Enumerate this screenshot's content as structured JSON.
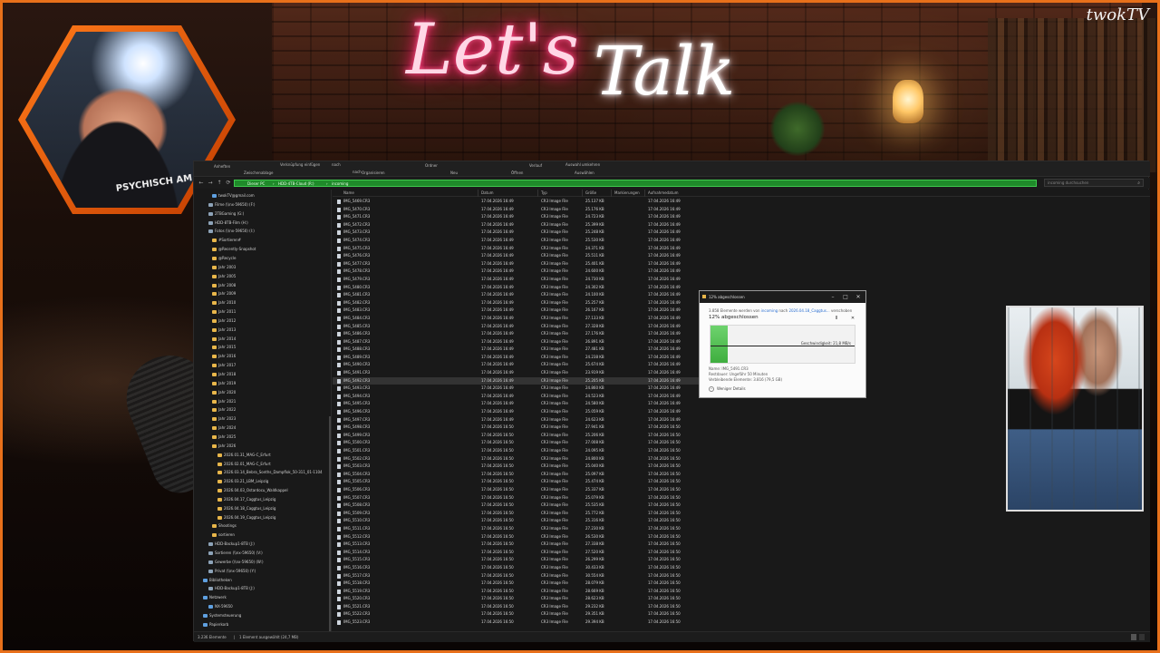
{
  "overlay": {
    "title_part1": "Let's",
    "title_part2": "Talk",
    "brand": "twokTV",
    "webcam_shirt": "PSYCHISCH AM",
    "colors": {
      "frame": "#e8701a",
      "neon_pink": "#ff2a70",
      "progress_green": "#3fae3f",
      "address_green": "#1f8a2a"
    }
  },
  "explorer": {
    "ribbon": [
      "Anheften",
      "Zwischenablage",
      "Verknüpfung einfügen",
      "nach",
      "nach",
      "Organisieren",
      "Ordner",
      "Neu",
      "Öffnen",
      "Verlauf",
      "Auswahl umkehren",
      "Auswählen"
    ],
    "breadcrumbs": [
      "Dieser PC",
      "HDD-4TB-Cloud (R:)",
      "incoming"
    ],
    "search_placeholder": "incoming durchsuchen",
    "nav_tree": [
      {
        "label": "twokTV@gmail.com",
        "icon": "user-icon"
      },
      {
        "label": "Filme (\\\\nx-59650) (F:)",
        "icon": "drive-icon"
      },
      {
        "label": "2TBGaming (G:)",
        "icon": "drive-icon"
      },
      {
        "label": "HDD-8TB-Film (H:)",
        "icon": "drive-icon"
      },
      {
        "label": "Fotos (\\\\nx-59650) (I:)",
        "icon": "drive-icon"
      },
      {
        "label": "#Sortieren#",
        "icon": "folder-icon"
      },
      {
        "label": "@Recently-Snapshot",
        "icon": "folder-icon"
      },
      {
        "label": "@Recycle",
        "icon": "folder-icon"
      },
      {
        "label": "Jahr 2003",
        "icon": "folder-icon"
      },
      {
        "label": "Jahr 2005",
        "icon": "folder-icon"
      },
      {
        "label": "Jahr 2008",
        "icon": "folder-icon"
      },
      {
        "label": "Jahr 2009",
        "icon": "folder-icon"
      },
      {
        "label": "Jahr 2010",
        "icon": "folder-icon"
      },
      {
        "label": "Jahr 2011",
        "icon": "folder-icon"
      },
      {
        "label": "Jahr 2012",
        "icon": "folder-icon"
      },
      {
        "label": "Jahr 2013",
        "icon": "folder-icon"
      },
      {
        "label": "Jahr 2014",
        "icon": "folder-icon"
      },
      {
        "label": "Jahr 2015",
        "icon": "folder-icon"
      },
      {
        "label": "Jahr 2016",
        "icon": "folder-icon"
      },
      {
        "label": "Jahr 2017",
        "icon": "folder-icon"
      },
      {
        "label": "Jahr 2018",
        "icon": "folder-icon"
      },
      {
        "label": "Jahr 2019",
        "icon": "folder-icon"
      },
      {
        "label": "Jahr 2020",
        "icon": "folder-icon"
      },
      {
        "label": "Jahr 2021",
        "icon": "folder-icon"
      },
      {
        "label": "Jahr 2022",
        "icon": "folder-icon"
      },
      {
        "label": "Jahr 2023",
        "icon": "folder-icon"
      },
      {
        "label": "Jahr 2024",
        "icon": "folder-icon"
      },
      {
        "label": "Jahr 2025",
        "icon": "folder-icon"
      },
      {
        "label": "Jahr 2026",
        "icon": "folder-icon"
      },
      {
        "label": "2026.01.31_MAG-C_Erfurt",
        "icon": "folder-icon"
      },
      {
        "label": "2026.02.01_MAG-C_Erfurt",
        "icon": "folder-icon"
      },
      {
        "label": "2026.03.14_Bebra_Sonths_Dampflok_50-311_01-1104",
        "icon": "folder-icon"
      },
      {
        "label": "2026.03.21_LBM_Leipzig",
        "icon": "folder-icon"
      },
      {
        "label": "2026.04.03_Ostardocu_Waldkappel",
        "icon": "folder-icon"
      },
      {
        "label": "2026.04.17_Caggtus_Leipzig",
        "icon": "folder-icon"
      },
      {
        "label": "2026.04.18_Caggtus_Leipzig",
        "icon": "folder-icon"
      },
      {
        "label": "2026.04.19_Caggtus_Leipzig",
        "icon": "folder-icon"
      },
      {
        "label": "Shootings",
        "icon": "folder-icon"
      },
      {
        "label": "sortieren",
        "icon": "folder-icon"
      },
      {
        "label": "HDD-Backup1-8TB (J:)",
        "icon": "drive-icon"
      },
      {
        "label": "Sortieren (\\\\nx-59650) (V:)",
        "icon": "drive-icon"
      },
      {
        "label": "Gewerbe (\\\\nx-59650) (W:)",
        "icon": "drive-icon"
      },
      {
        "label": "Privat (\\\\nx-59650) (Y:)",
        "icon": "drive-icon"
      },
      {
        "label": "Bibliotheken",
        "icon": "library-icon"
      },
      {
        "label": "HDD-Backup1-8TB (J:)",
        "icon": "drive-icon"
      },
      {
        "label": "Netzwerk",
        "icon": "network-icon"
      },
      {
        "label": "NX-59650",
        "icon": "computer-icon"
      },
      {
        "label": "Systemsteuerung",
        "icon": "control-panel-icon"
      },
      {
        "label": "Papierkorb",
        "icon": "recycle-bin-icon"
      }
    ],
    "columns": [
      "Name",
      "Datum",
      "Typ",
      "Größe",
      "Markierungen",
      "Aufnahmedatum"
    ],
    "files": [
      {
        "name": "IMG_5469.CR3",
        "date": "17.04.2026 16:49",
        "type": "CR3 Image File",
        "size": "25.137 KB",
        "taken": "17.04.2026 16:49"
      },
      {
        "name": "IMG_5470.CR3",
        "date": "17.04.2026 16:49",
        "type": "CR3 Image File",
        "size": "25.176 KB",
        "taken": "17.04.2026 16:49"
      },
      {
        "name": "IMG_5471.CR3",
        "date": "17.04.2026 16:49",
        "type": "CR3 Image File",
        "size": "24.723 KB",
        "taken": "17.04.2026 16:49"
      },
      {
        "name": "IMG_5472.CR3",
        "date": "17.04.2026 16:49",
        "type": "CR3 Image File",
        "size": "25.399 KB",
        "taken": "17.04.2026 16:49"
      },
      {
        "name": "IMG_5473.CR3",
        "date": "17.04.2026 16:49",
        "type": "CR3 Image File",
        "size": "25.248 KB",
        "taken": "17.04.2026 16:49"
      },
      {
        "name": "IMG_5474.CR3",
        "date": "17.04.2026 16:49",
        "type": "CR3 Image File",
        "size": "25.530 KB",
        "taken": "17.04.2026 16:49"
      },
      {
        "name": "IMG_5475.CR3",
        "date": "17.04.2026 16:49",
        "type": "CR3 Image File",
        "size": "24.371 KB",
        "taken": "17.04.2026 16:49"
      },
      {
        "name": "IMG_5476.CR3",
        "date": "17.04.2026 16:49",
        "type": "CR3 Image File",
        "size": "25.511 KB",
        "taken": "17.04.2026 16:49"
      },
      {
        "name": "IMG_5477.CR3",
        "date": "17.04.2026 16:49",
        "type": "CR3 Image File",
        "size": "25.401 KB",
        "taken": "17.04.2026 16:49"
      },
      {
        "name": "IMG_5478.CR3",
        "date": "17.04.2026 16:49",
        "type": "CR3 Image File",
        "size": "24.600 KB",
        "taken": "17.04.2026 16:49"
      },
      {
        "name": "IMG_5479.CR3",
        "date": "17.04.2026 16:49",
        "type": "CR3 Image File",
        "size": "24.730 KB",
        "taken": "17.04.2026 16:49"
      },
      {
        "name": "IMG_5480.CR3",
        "date": "17.04.2026 16:49",
        "type": "CR3 Image File",
        "size": "24.302 KB",
        "taken": "17.04.2026 16:49"
      },
      {
        "name": "IMG_5481.CR3",
        "date": "17.04.2026 16:49",
        "type": "CR3 Image File",
        "size": "24.100 KB",
        "taken": "17.04.2026 16:49"
      },
      {
        "name": "IMG_5482.CR3",
        "date": "17.04.2026 16:49",
        "type": "CR3 Image File",
        "size": "25.257 KB",
        "taken": "17.04.2026 16:49"
      },
      {
        "name": "IMG_5483.CR3",
        "date": "17.04.2026 16:49",
        "type": "CR3 Image File",
        "size": "26.167 KB",
        "taken": "17.04.2026 16:49"
      },
      {
        "name": "IMG_5484.CR3",
        "date": "17.04.2026 16:49",
        "type": "CR3 Image File",
        "size": "27.133 KB",
        "taken": "17.04.2026 16:49"
      },
      {
        "name": "IMG_5485.CR3",
        "date": "17.04.2026 16:49",
        "type": "CR3 Image File",
        "size": "27.328 KB",
        "taken": "17.04.2026 16:49"
      },
      {
        "name": "IMG_5486.CR3",
        "date": "17.04.2026 16:49",
        "type": "CR3 Image File",
        "size": "27.176 KB",
        "taken": "17.04.2026 16:49"
      },
      {
        "name": "IMG_5487.CR3",
        "date": "17.04.2026 16:49",
        "type": "CR3 Image File",
        "size": "26.891 KB",
        "taken": "17.04.2026 16:49"
      },
      {
        "name": "IMG_5488.CR3",
        "date": "17.04.2026 16:49",
        "type": "CR3 Image File",
        "size": "27.481 KB",
        "taken": "17.04.2026 16:49"
      },
      {
        "name": "IMG_5489.CR3",
        "date": "17.04.2026 16:49",
        "type": "CR3 Image File",
        "size": "24.238 KB",
        "taken": "17.04.2026 16:49"
      },
      {
        "name": "IMG_5490.CR3",
        "date": "17.04.2026 16:49",
        "type": "CR3 Image File",
        "size": "25.674 KB",
        "taken": "17.04.2026 16:49"
      },
      {
        "name": "IMG_5491.CR3",
        "date": "17.04.2026 16:49",
        "type": "CR3 Image File",
        "size": "23.919 KB",
        "taken": "17.04.2026 16:49"
      },
      {
        "name": "IMG_5492.CR3",
        "date": "17.04.2026 16:49",
        "type": "CR3 Image File",
        "size": "25.205 KB",
        "taken": "17.04.2026 16:49"
      },
      {
        "name": "IMG_5493.CR3",
        "date": "17.04.2026 16:49",
        "type": "CR3 Image File",
        "size": "24.860 KB",
        "taken": "17.04.2026 16:49"
      },
      {
        "name": "IMG_5494.CR3",
        "date": "17.04.2026 16:49",
        "type": "CR3 Image File",
        "size": "24.523 KB",
        "taken": "17.04.2026 16:49"
      },
      {
        "name": "IMG_5495.CR3",
        "date": "17.04.2026 16:49",
        "type": "CR3 Image File",
        "size": "24.580 KB",
        "taken": "17.04.2026 16:49"
      },
      {
        "name": "IMG_5496.CR3",
        "date": "17.04.2026 16:49",
        "type": "CR3 Image File",
        "size": "25.059 KB",
        "taken": "17.04.2026 16:49"
      },
      {
        "name": "IMG_5497.CR3",
        "date": "17.04.2026 16:49",
        "type": "CR3 Image File",
        "size": "24.623 KB",
        "taken": "17.04.2026 16:49"
      },
      {
        "name": "IMG_5498.CR3",
        "date": "17.04.2026 16:50",
        "type": "CR3 Image File",
        "size": "27.941 KB",
        "taken": "17.04.2026 16:50"
      },
      {
        "name": "IMG_5499.CR3",
        "date": "17.04.2026 16:50",
        "type": "CR3 Image File",
        "size": "25.206 KB",
        "taken": "17.04.2026 16:50"
      },
      {
        "name": "IMG_5500.CR3",
        "date": "17.04.2026 16:50",
        "type": "CR3 Image File",
        "size": "27.008 KB",
        "taken": "17.04.2026 16:50"
      },
      {
        "name": "IMG_5501.CR3",
        "date": "17.04.2026 16:50",
        "type": "CR3 Image File",
        "size": "24.095 KB",
        "taken": "17.04.2026 16:50"
      },
      {
        "name": "IMG_5502.CR3",
        "date": "17.04.2026 16:50",
        "type": "CR3 Image File",
        "size": "24.800 KB",
        "taken": "17.04.2026 16:50"
      },
      {
        "name": "IMG_5503.CR3",
        "date": "17.04.2026 16:50",
        "type": "CR3 Image File",
        "size": "25.040 KB",
        "taken": "17.04.2026 16:50"
      },
      {
        "name": "IMG_5504.CR3",
        "date": "17.04.2026 16:50",
        "type": "CR3 Image File",
        "size": "25.097 KB",
        "taken": "17.04.2026 16:50"
      },
      {
        "name": "IMG_5505.CR3",
        "date": "17.04.2026 16:50",
        "type": "CR3 Image File",
        "size": "25.474 KB",
        "taken": "17.04.2026 16:50"
      },
      {
        "name": "IMG_5506.CR3",
        "date": "17.04.2026 16:50",
        "type": "CR3 Image File",
        "size": "25.337 KB",
        "taken": "17.04.2026 16:50"
      },
      {
        "name": "IMG_5507.CR3",
        "date": "17.04.2026 16:50",
        "type": "CR3 Image File",
        "size": "25.079 KB",
        "taken": "17.04.2026 16:50"
      },
      {
        "name": "IMG_5508.CR3",
        "date": "17.04.2026 16:50",
        "type": "CR3 Image File",
        "size": "25.535 KB",
        "taken": "17.04.2026 16:50"
      },
      {
        "name": "IMG_5509.CR3",
        "date": "17.04.2026 16:50",
        "type": "CR3 Image File",
        "size": "25.772 KB",
        "taken": "17.04.2026 16:50"
      },
      {
        "name": "IMG_5510.CR3",
        "date": "17.04.2026 16:50",
        "type": "CR3 Image File",
        "size": "25.316 KB",
        "taken": "17.04.2026 16:50"
      },
      {
        "name": "IMG_5511.CR3",
        "date": "17.04.2026 16:50",
        "type": "CR3 Image File",
        "size": "27.230 KB",
        "taken": "17.04.2026 16:50"
      },
      {
        "name": "IMG_5512.CR3",
        "date": "17.04.2026 16:50",
        "type": "CR3 Image File",
        "size": "26.530 KB",
        "taken": "17.04.2026 16:50"
      },
      {
        "name": "IMG_5513.CR3",
        "date": "17.04.2026 16:50",
        "type": "CR3 Image File",
        "size": "27.338 KB",
        "taken": "17.04.2026 16:50"
      },
      {
        "name": "IMG_5514.CR3",
        "date": "17.04.2026 16:50",
        "type": "CR3 Image File",
        "size": "27.520 KB",
        "taken": "17.04.2026 16:50"
      },
      {
        "name": "IMG_5515.CR3",
        "date": "17.04.2026 16:50",
        "type": "CR3 Image File",
        "size": "26.299 KB",
        "taken": "17.04.2026 16:50"
      },
      {
        "name": "IMG_5516.CR3",
        "date": "17.04.2026 16:50",
        "type": "CR3 Image File",
        "size": "30.433 KB",
        "taken": "17.04.2026 16:50"
      },
      {
        "name": "IMG_5517.CR3",
        "date": "17.04.2026 16:50",
        "type": "CR3 Image File",
        "size": "30.554 KB",
        "taken": "17.04.2026 16:50"
      },
      {
        "name": "IMG_5518.CR3",
        "date": "17.04.2026 16:50",
        "type": "CR3 Image File",
        "size": "28.079 KB",
        "taken": "17.04.2026 16:50"
      },
      {
        "name": "IMG_5519.CR3",
        "date": "17.04.2026 16:50",
        "type": "CR3 Image File",
        "size": "28.669 KB",
        "taken": "17.04.2026 16:50"
      },
      {
        "name": "IMG_5520.CR3",
        "date": "17.04.2026 16:50",
        "type": "CR3 Image File",
        "size": "28.623 KB",
        "taken": "17.04.2026 16:50"
      },
      {
        "name": "IMG_5521.CR3",
        "date": "17.04.2026 16:50",
        "type": "CR3 Image File",
        "size": "29.232 KB",
        "taken": "17.04.2026 16:50"
      },
      {
        "name": "IMG_5522.CR3",
        "date": "17.04.2026 16:50",
        "type": "CR3 Image File",
        "size": "29.351 KB",
        "taken": "17.04.2026 16:50"
      },
      {
        "name": "IMG_5523.CR3",
        "date": "17.04.2026 16:50",
        "type": "CR3 Image File",
        "size": "29.394 KB",
        "taken": "17.04.2026 16:50"
      }
    ],
    "selected_row": 23,
    "status": {
      "count": "3.236 Elemente",
      "selection": "1 Element ausgewählt (24,7 MB)"
    }
  },
  "copy_dialog": {
    "title": "12% abgeschlossen",
    "line_prefix": "3.858 Elemente werden von",
    "source": "incoming",
    "line_mid": "nach",
    "destination": "2026.04.18_Caggtus...",
    "line_suffix": "verschoben",
    "percent": "12% abgeschlossen",
    "progress": 0.12,
    "speed": "Geschwindigkeit: 21,8 MB/s",
    "name": "Name: IMG_5491.CR3",
    "remaining": "Restdauer: Ungefähr 50 Minuten",
    "items_left": "Verbleibende Elemente: 3.816 (79,5 GB)",
    "details_label": "Weniger Details",
    "pause_label": "II",
    "cancel_label": "✕"
  }
}
